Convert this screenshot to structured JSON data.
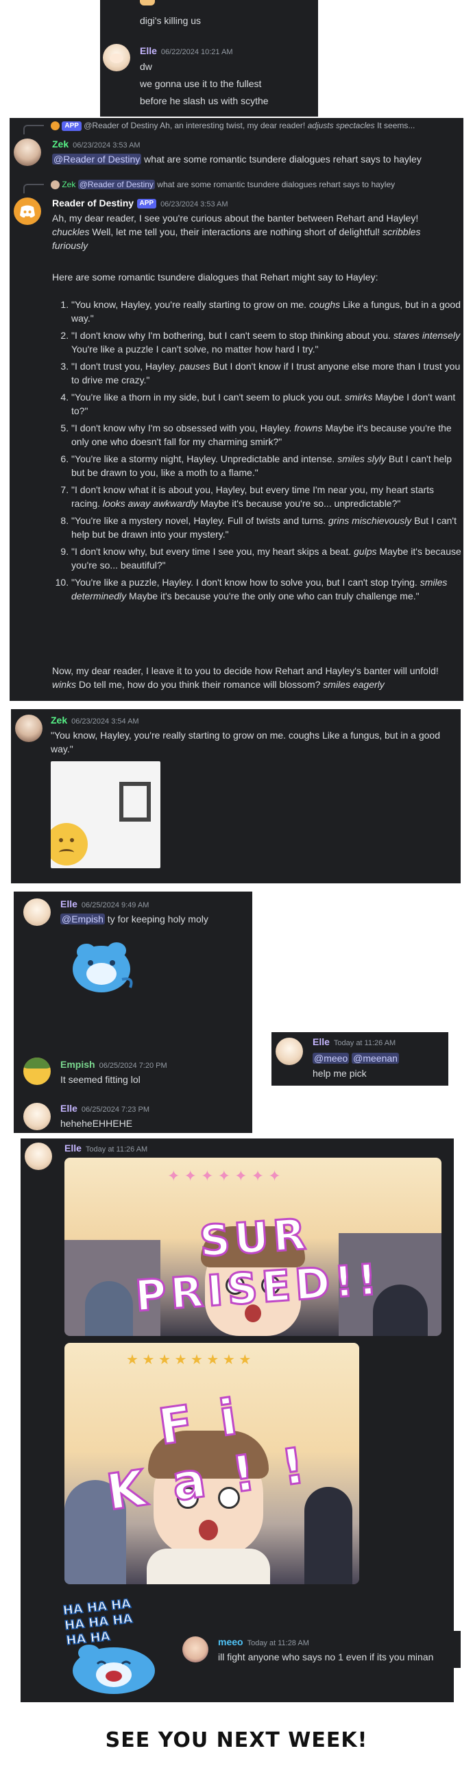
{
  "panel1": {
    "msg0": {
      "text": "digi's killing us"
    },
    "elle": {
      "name": "Elle",
      "time": "06/22/2024 10:21 AM",
      "lines": [
        "dw",
        "we gonna use it to the fullest",
        "before he slash us with scythe"
      ]
    }
  },
  "panel2": {
    "reply_top": {
      "badge": "APP",
      "mention": "@Reader of Destiny",
      "text": "Ah, an interesting twist, my dear reader!",
      "action": "adjusts spectacles",
      "tail": "It seems..."
    },
    "zek": {
      "name": "Zek",
      "time": "06/23/2024 3:53 AM",
      "mention": "@Reader of Destiny",
      "text": "what are some romantic tsundere dialogues rehart says to hayley"
    },
    "reply_bot": {
      "name": "Zek",
      "mention": "@Reader of Destiny",
      "text": "what are some romantic tsundere dialogues rehart says to hayley"
    },
    "bot": {
      "name": "Reader of Destiny",
      "badge": "APP",
      "time": "06/23/2024 3:53 AM",
      "intro": [
        {
          "t": "Ah, my dear reader, I see you're curious about the banter between Rehart and Hayley! ",
          "i": false
        },
        {
          "t": "chuckles",
          "i": true
        },
        {
          "t": " Well, let me tell you, their interactions are nothing short of delightful! ",
          "i": false
        },
        {
          "t": "scribbles furiously",
          "i": true
        }
      ],
      "lead": "Here are some romantic tsundere dialogues that Rehart might say to Hayley:",
      "items": [
        [
          {
            "t": "\"You know, Hayley, you're really starting to grow on me. ",
            "i": false
          },
          {
            "t": "coughs",
            "i": true
          },
          {
            "t": " Like a fungus, but in a good way.\"",
            "i": false
          }
        ],
        [
          {
            "t": "\"I don't know why I'm bothering, but I can't seem to stop thinking about you. ",
            "i": false
          },
          {
            "t": "stares intensely",
            "i": true
          },
          {
            "t": " You're like a puzzle I can't solve, no matter how hard I try.\"",
            "i": false
          }
        ],
        [
          {
            "t": "\"I don't trust you, Hayley. ",
            "i": false
          },
          {
            "t": "pauses",
            "i": true
          },
          {
            "t": " But I don't know if I trust anyone else more than I trust you to drive me crazy.\"",
            "i": false
          }
        ],
        [
          {
            "t": "\"You're like a thorn in my side, but I can't seem to pluck you out. ",
            "i": false
          },
          {
            "t": "smirks",
            "i": true
          },
          {
            "t": " Maybe I don't want to?\"",
            "i": false
          }
        ],
        [
          {
            "t": "\"I don't know why I'm so obsessed with you, Hayley. ",
            "i": false
          },
          {
            "t": "frowns",
            "i": true
          },
          {
            "t": " Maybe it's because you're the only one who doesn't fall for my charming smirk?\"",
            "i": false
          }
        ],
        [
          {
            "t": "\"You're like a stormy night, Hayley. Unpredictable and intense. ",
            "i": false
          },
          {
            "t": "smiles slyly",
            "i": true
          },
          {
            "t": " But I can't help but be drawn to you, like a moth to a flame.\"",
            "i": false
          }
        ],
        [
          {
            "t": "\"I don't know what it is about you, Hayley, but every time I'm near you, my heart starts racing. ",
            "i": false
          },
          {
            "t": "looks away awkwardly",
            "i": true
          },
          {
            "t": " Maybe it's because you're so... unpredictable?\"",
            "i": false
          }
        ],
        [
          {
            "t": "\"You're like a mystery novel, Hayley. Full of twists and turns. ",
            "i": false
          },
          {
            "t": "grins mischievously",
            "i": true
          },
          {
            "t": " But I can't help but be drawn into your mystery.\"",
            "i": false
          }
        ],
        [
          {
            "t": "\"I don't know why, but every time I see you, my heart skips a beat. ",
            "i": false
          },
          {
            "t": "gulps",
            "i": true
          },
          {
            "t": " Maybe it's because you're so... beautiful?\"",
            "i": false
          }
        ],
        [
          {
            "t": "\"You're like a puzzle, Hayley. I don't know how to solve you, but I can't stop trying. ",
            "i": false
          },
          {
            "t": "smiles determinedly",
            "i": true
          },
          {
            "t": " Maybe it's because you're the only one who can truly challenge me.\"",
            "i": false
          }
        ]
      ],
      "outro": [
        {
          "t": "Now, my dear reader, I leave it to you to decide how Rehart and Hayley's banter will unfold! ",
          "i": false
        },
        {
          "t": "winks",
          "i": true
        },
        {
          "t": " Do tell me, how do you think their romance will blossom? ",
          "i": false
        },
        {
          "t": "smiles eagerly",
          "i": true
        }
      ]
    }
  },
  "panel3": {
    "zek": {
      "name": "Zek",
      "time": "06/23/2024 3:54 AM",
      "text": "\"You know, Hayley, you're really starting to grow on me. coughs Like a fungus, but in a good way.\""
    }
  },
  "panel4": {
    "elle1": {
      "name": "Elle",
      "time": "06/25/2024 9:49 AM",
      "mention": "@Empish",
      "text": "ty for keeping holy moly"
    },
    "empish": {
      "name": "Empish",
      "time": "06/25/2024 7:20 PM",
      "text": "It seemed fitting lol"
    },
    "elle2": {
      "name": "Elle",
      "time": "06/25/2024 7:23 PM",
      "text": "heheheEHHEHE"
    }
  },
  "panel5": {
    "elle": {
      "name": "Elle",
      "time": "Today at 11:26 AM",
      "mention1": "@meeo",
      "mention2": "@meenan",
      "text": "help me pick"
    }
  },
  "panel6": {
    "elle": {
      "name": "Elle",
      "time": "Today at 11:26 AM"
    },
    "img1_text": "SUR PRISED!!",
    "img2_text": "Fi Ka!!",
    "sticker_text": "HA HA HA HA HA HA HA HA"
  },
  "panel7": {
    "meeo": {
      "name": "meeo",
      "time": "Today at 11:28 AM",
      "text": "ill fight anyone who says no 1 even if its you minan"
    }
  },
  "footer": {
    "text": "SEE YOU NEXT WEEK!"
  },
  "colors": {
    "bg": "#1e1f22",
    "zek": "#57f287",
    "elle": "#c4b5fd",
    "empish": "#7bd88f",
    "meeo": "#4fc3f7",
    "mention_bg": "#3c4270",
    "blurple": "#5865f2"
  }
}
